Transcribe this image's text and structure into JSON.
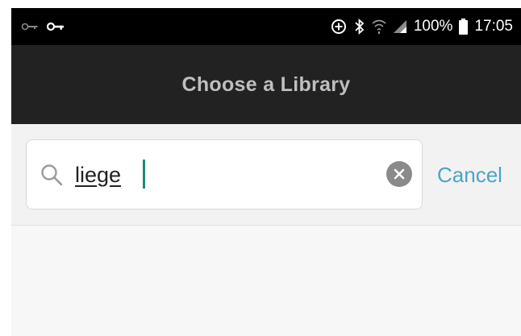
{
  "status_bar": {
    "battery": "100%",
    "time": "17:05",
    "icons": [
      "vpn-key-icon",
      "key-icon",
      "data-saver-icon",
      "bluetooth-icon",
      "wifi-icon",
      "cell-signal-icon",
      "battery-icon"
    ]
  },
  "header": {
    "title": "Choose a Library"
  },
  "search": {
    "value": "liege",
    "cancel_label": "Cancel"
  },
  "colors": {
    "accent": "#4aa4c8",
    "header_bg": "#222222",
    "status_bg": "#000000",
    "caret": "#1b8a7a"
  }
}
